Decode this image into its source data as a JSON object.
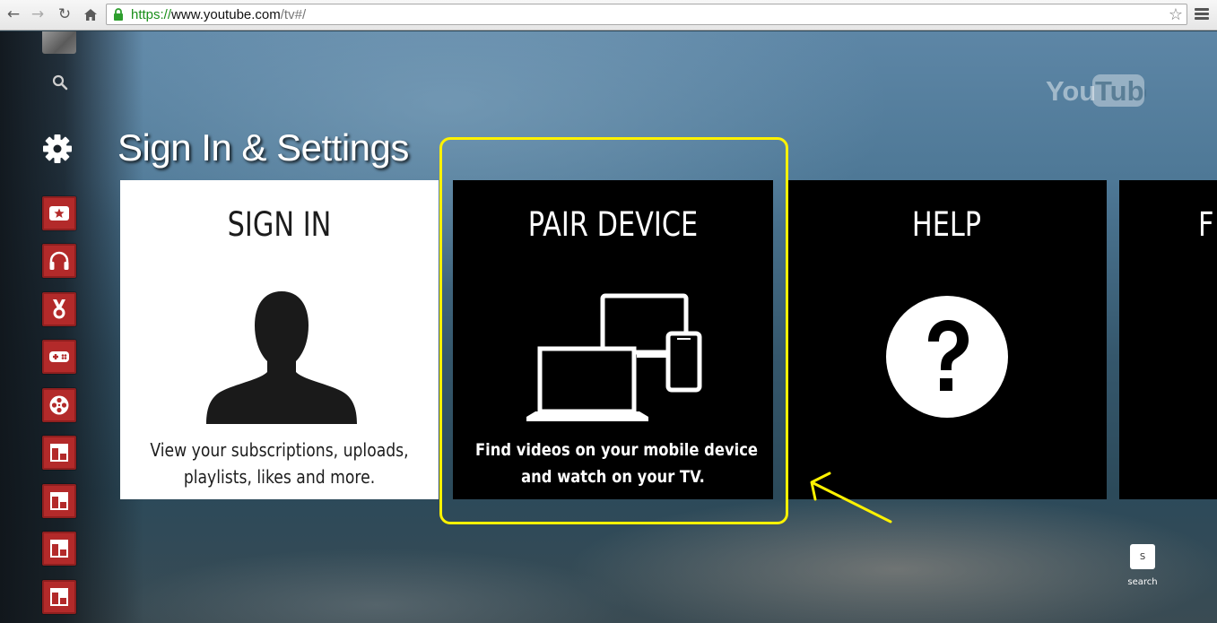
{
  "browser": {
    "url_scheme": "https://",
    "url_host": "www.youtube.com",
    "url_path": "/tv#/",
    "icons": [
      "back-icon",
      "forward-icon",
      "reload-icon",
      "home-icon",
      "lock-icon",
      "bookmark-star-icon",
      "menu-icon"
    ]
  },
  "page": {
    "title": "Sign In & Settings",
    "logo": "YouTube"
  },
  "nav": {
    "icons": [
      "avatar",
      "search-icon",
      "gear-icon",
      "star-icon",
      "headphones-icon",
      "medal-icon",
      "gamepad-icon",
      "film-reel-icon",
      "layout-icon",
      "layout-icon",
      "layout-icon",
      "layout-icon"
    ]
  },
  "cards": {
    "signin": {
      "title": "SIGN IN",
      "desc_line1": "View your subscriptions, uploads,",
      "desc_line2": "playlists, likes and more."
    },
    "pair": {
      "title": "PAIR DEVICE",
      "desc_line1": "Find videos on your mobile device",
      "desc_line2": "and watch on your TV."
    },
    "help": {
      "title": "HELP"
    },
    "fourth": {
      "title": "F"
    }
  },
  "search_hint": {
    "key": "S",
    "label": "search"
  },
  "colors": {
    "highlight": "#fff200",
    "nav_tile": "#b32a2a",
    "url_scheme": "#1a8f1a"
  }
}
